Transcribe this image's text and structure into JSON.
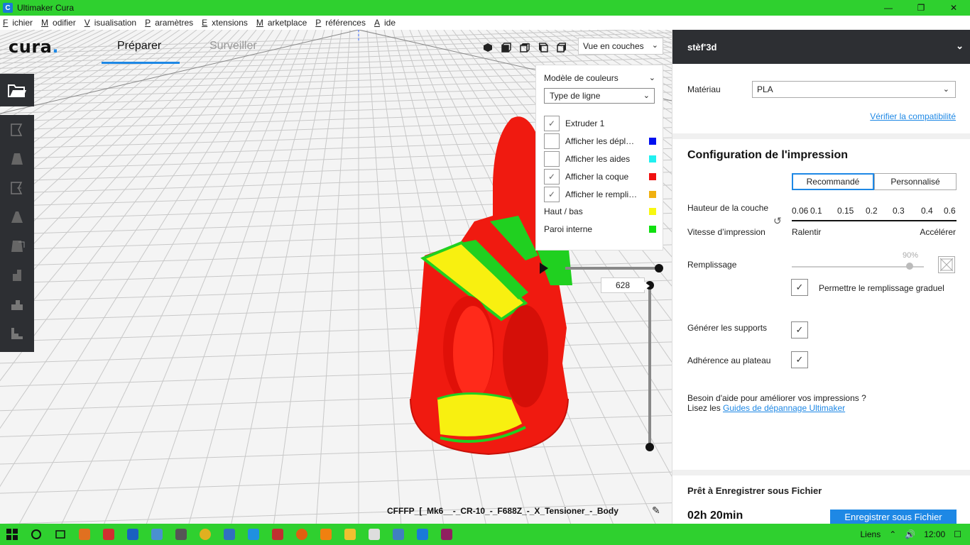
{
  "window": {
    "title": "Ultimaker Cura",
    "app_icon_letter": "C"
  },
  "menu": [
    {
      "u": "F",
      "rest": "ichier"
    },
    {
      "u": "M",
      "rest": "odifier"
    },
    {
      "u": "V",
      "rest": "isualisation"
    },
    {
      "u": "P",
      "rest": "aramètres"
    },
    {
      "u": "E",
      "rest": "xtensions"
    },
    {
      "u": "M",
      "rest": "arketplace"
    },
    {
      "u": "P",
      "rest": "références"
    },
    {
      "u": "A",
      "rest": "ide"
    }
  ],
  "header": {
    "logo": "cura",
    "logo_dot": ".",
    "tab_prepare": "Préparer",
    "tab_monitor": "Surveiller",
    "view_mode": "Vue en couches"
  },
  "color_panel": {
    "scheme_label": "Modèle de couleurs",
    "scheme_value": "Type de ligne",
    "rows": [
      {
        "label": "Extruder 1",
        "checked": true,
        "color": null
      },
      {
        "label": "Afficher les dépl…",
        "checked": false,
        "color": "#0010f0"
      },
      {
        "label": "Afficher les aides",
        "checked": false,
        "color": "#20f0f0"
      },
      {
        "label": "Afficher la coque",
        "checked": true,
        "color": "#f01010"
      },
      {
        "label": "Afficher le rempli…",
        "checked": true,
        "color": "#f0b010"
      }
    ],
    "legend": [
      {
        "label": "Haut / bas",
        "color": "#f8f810"
      },
      {
        "label": "Paroi interne",
        "color": "#10e010"
      }
    ]
  },
  "layer": {
    "current": "628"
  },
  "filename": "CFFFP_[_Mk6__-_CR-10_-_F688Z_-_X_Tensioner_-_Body",
  "right_panel": {
    "printer": "stèf'3d",
    "material_label": "Matériau",
    "material_value": "PLA",
    "compat_link": "Vérifier la compatibilité",
    "config_title": "Configuration de l'impression",
    "mode_recommended": "Recommandé",
    "mode_custom": "Personnalisé",
    "layer_height_label": "Hauteur de la couche",
    "layer_heights": [
      "0.06",
      "0.1",
      "0.15",
      "0.2",
      "0.3",
      "0.4",
      "0.6"
    ],
    "speed_label": "Vitesse d’impression",
    "speed_slow": "Ralentir",
    "speed_fast": "Accélérer",
    "infill_label": "Remplissage",
    "infill_percent": "90%",
    "gradual_label": "Permettre le remplissage graduel",
    "support_label": "Générer les supports",
    "adhesion_label": "Adhérence au plateau",
    "help_line1": "Besoin d'aide pour améliorer vos impressions ?",
    "help_line2_prefix": "Lisez les ",
    "help_link": "Guides de dépannage Ultimaker",
    "ready_label": "Prêt à Enregistrer sous Fichier",
    "print_time": "02h 20min",
    "save_button": "Enregistrer sous Fichier"
  },
  "taskbar": {
    "links_label": "Liens",
    "clock": "12:00"
  }
}
